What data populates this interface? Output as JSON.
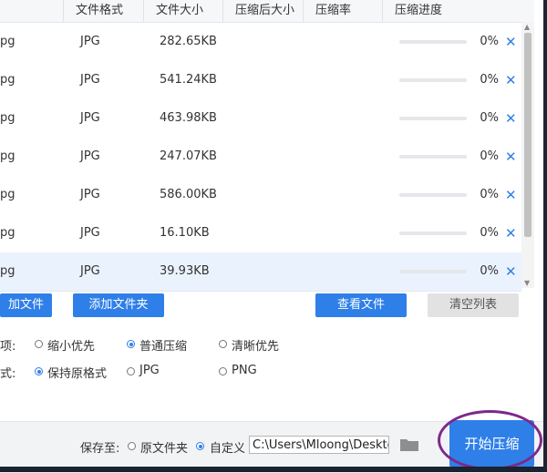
{
  "columns": [
    "文件格式",
    "文件大小",
    "压缩后大小",
    "压缩率",
    "压缩进度"
  ],
  "first_col_fragment": "pg",
  "rows": [
    {
      "format": "JPG",
      "size": "282.65KB",
      "progress_pct": 0,
      "progress_text": "0%"
    },
    {
      "format": "JPG",
      "size": "541.24KB",
      "progress_pct": 0,
      "progress_text": "0%"
    },
    {
      "format": "JPG",
      "size": "463.98KB",
      "progress_pct": 0,
      "progress_text": "0%"
    },
    {
      "format": "JPG",
      "size": "247.07KB",
      "progress_pct": 0,
      "progress_text": "0%"
    },
    {
      "format": "JPG",
      "size": "586.00KB",
      "progress_pct": 0,
      "progress_text": "0%"
    },
    {
      "format": "JPG",
      "size": "16.10KB",
      "progress_pct": 0,
      "progress_text": "0%"
    },
    {
      "format": "JPG",
      "size": "39.93KB",
      "progress_pct": 0,
      "progress_text": "0%"
    }
  ],
  "remove_symbol": "✕",
  "buttons": {
    "add_file": "加文件",
    "add_folder": "添加文件夹",
    "view_file": "查看文件",
    "clear_list": "清空列表",
    "start": "开始压缩"
  },
  "compress_options": {
    "label": "项:",
    "items": [
      "缩小优先",
      "普通压缩",
      "清晰优先"
    ],
    "selected": 1
  },
  "output_format": {
    "label": "式:",
    "items": [
      "保持原格式",
      "JPG",
      "PNG"
    ],
    "selected": 0
  },
  "save_to": {
    "label": "保存至:",
    "items": [
      "原文件夹",
      "自定义"
    ],
    "selected": 1,
    "path": "C:\\Users\\Mloong\\Desktop"
  },
  "icons": {
    "folder": "folder-icon",
    "remove": "close-icon"
  },
  "colors": {
    "accent": "#2f7fe8",
    "annotation_circle": "#7c2a8a"
  }
}
